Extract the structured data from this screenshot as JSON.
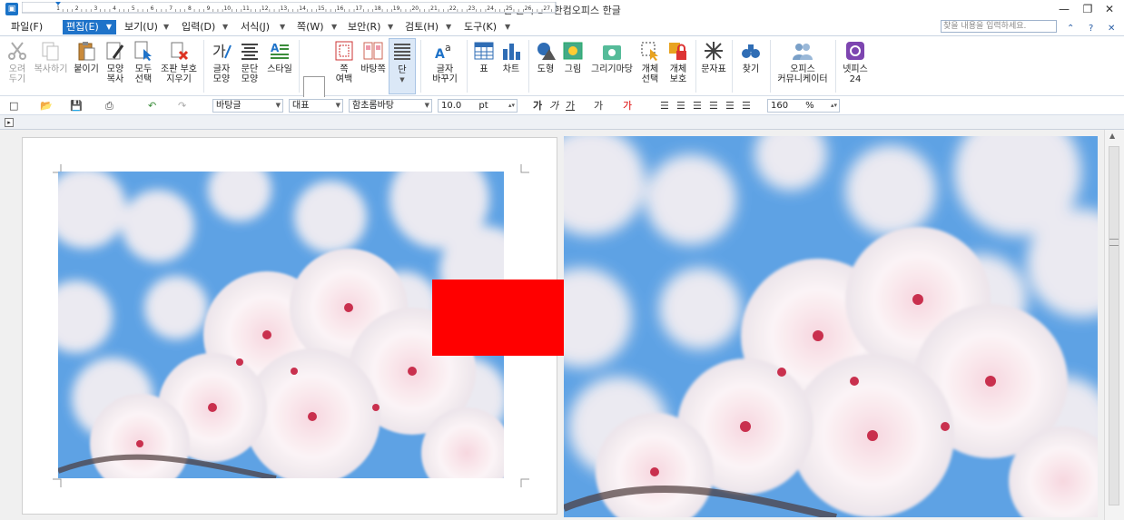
{
  "title": "빈 문서 1 - 한컴오피스 한글",
  "window_buttons": {
    "minimize": "—",
    "restore": "❐",
    "close": "✕"
  },
  "menu": {
    "file": "파일(F)",
    "edit": "편집(E)",
    "view": "보기(U)",
    "insert": "입력(D)",
    "format": "서식(J)",
    "page": "쪽(W)",
    "security": "보안(R)",
    "review": "검토(H)",
    "tools": "도구(K)"
  },
  "search": {
    "placeholder": "찾을 내용을 입력하세요."
  },
  "menu_right": {
    "collapse": "⌃",
    "help": "?",
    "close": "✕"
  },
  "ribbon": {
    "cut": "오려\n두기",
    "copy": "복사하기",
    "paste": "붙이기",
    "format_copy": "모양\n복사",
    "select_all": "모두\n선택",
    "clear_format": "조판 부호\n지우기",
    "char_shape": "글자\n모양",
    "para_shape": "문단\n모양",
    "style": "스타일",
    "margin": "쪽\n여백",
    "background": "바탕쪽",
    "column": "단",
    "change_char": "글자\n바꾸기",
    "table": "표",
    "chart": "차트",
    "shape": "도형",
    "picture": "그림",
    "drawing_market": "그리기마당",
    "object_select": "개체\n선택",
    "object_protect": "개체\n보호",
    "symbols": "문자표",
    "find": "찾기",
    "office_community": "오피스\n커뮤니케이터",
    "netffice": "넷피스\n24"
  },
  "fmt": {
    "style": "바탕글",
    "lang": "대표",
    "font": "함초롬바탕",
    "size": "10.0",
    "unit": "pt",
    "bold": "가",
    "italic": "가",
    "underline": "가",
    "strike": "가",
    "color": "가",
    "zoom": "160",
    "zoom_unit": "%"
  },
  "ruler": {
    "ticks": [
      "1",
      "2",
      "3",
      "4",
      "5",
      "6",
      "7",
      "8",
      "9",
      "10",
      "11",
      "12",
      "13",
      "14",
      "15",
      "16",
      "17",
      "18",
      "19",
      "20",
      "21",
      "22",
      "23",
      "24",
      "25",
      "26",
      "27"
    ]
  },
  "colors": {
    "accent": "#1f73c9",
    "arrow": "#ff0000",
    "sky": "#4f9be0",
    "petal": "#f6eef0"
  }
}
